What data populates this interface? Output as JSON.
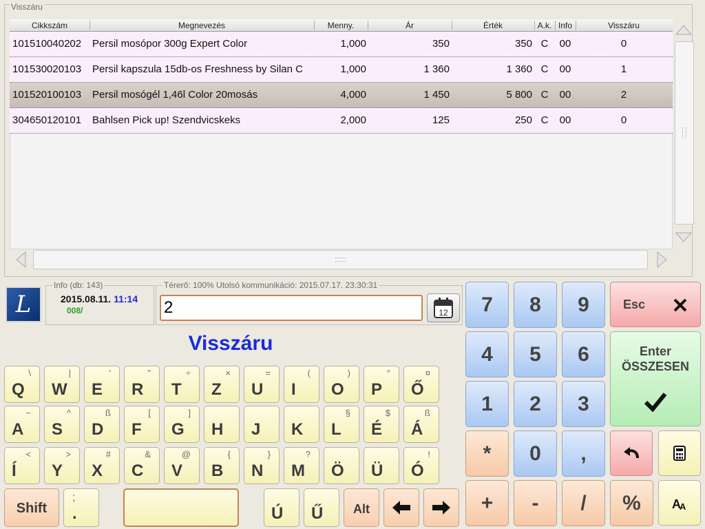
{
  "group_title": "Visszáru",
  "table": {
    "headers": [
      "Cikkszám",
      "Megnevezés",
      "Menny.",
      "Ár",
      "Érték",
      "A.k.",
      "Info",
      "Visszáru"
    ],
    "rows": [
      {
        "code": "101510040202",
        "name": "Persil mosópor 300g Expert Color",
        "qty": "1,000",
        "price": "350",
        "value": "350",
        "ak": "C",
        "info": "00",
        "ret": "0"
      },
      {
        "code": "101530020103",
        "name": "Persil kapszula 15db-os Freshness by Silan C",
        "qty": "1,000",
        "price": "1 360",
        "value": "1 360",
        "ak": "C",
        "info": "00",
        "ret": "1"
      },
      {
        "code": "101520100103",
        "name": "Persil mosógél 1,46l Color 20mosás",
        "qty": "4,000",
        "price": "1 450",
        "value": "5 800",
        "ak": "C",
        "info": "00",
        "ret": "2"
      },
      {
        "code": "304650120101",
        "name": "Bahlsen Pick up! Szendvicskeks",
        "qty": "2,000",
        "price": "125",
        "value": "250",
        "ak": "C",
        "info": "00",
        "ret": "0"
      }
    ],
    "selected_row": 2
  },
  "info": {
    "label": "Info (db: 143)",
    "date": "2015.08.11.",
    "time": "11:14",
    "code": "008/"
  },
  "status": {
    "label": "Térerő: 100%  Utolsó kommunikáció: 2015.07.17. 23:30:31"
  },
  "input": {
    "value": "2"
  },
  "calendar_day": "12",
  "mode_title": "Visszáru",
  "keyboard": {
    "row1": [
      {
        "m": "Q",
        "s": "\\"
      },
      {
        "m": "W",
        "s": "|"
      },
      {
        "m": "E",
        "s": "'"
      },
      {
        "m": "R",
        "s": "\""
      },
      {
        "m": "T",
        "s": "÷"
      },
      {
        "m": "Z",
        "s": "×"
      },
      {
        "m": "U",
        "s": "="
      },
      {
        "m": "I",
        "s": "("
      },
      {
        "m": "O",
        "s": ")"
      },
      {
        "m": "P",
        "s": "°"
      },
      {
        "m": "Ő",
        "s": "¤"
      }
    ],
    "row2": [
      {
        "m": "A",
        "s": "~"
      },
      {
        "m": "S",
        "s": "^"
      },
      {
        "m": "D",
        "s": "ß"
      },
      {
        "m": "F",
        "s": "["
      },
      {
        "m": "G",
        "s": "]"
      },
      {
        "m": "H",
        "s": ""
      },
      {
        "m": "J",
        "s": ""
      },
      {
        "m": "K",
        "s": ""
      },
      {
        "m": "L",
        "s": "§"
      },
      {
        "m": "É",
        "s": "$"
      },
      {
        "m": "Á",
        "s": "ß"
      }
    ],
    "row3": [
      {
        "m": "Í",
        "s": "<"
      },
      {
        "m": "Y",
        "s": ">"
      },
      {
        "m": "X",
        "s": "#"
      },
      {
        "m": "C",
        "s": "&"
      },
      {
        "m": "V",
        "s": "@"
      },
      {
        "m": "B",
        "s": "{"
      },
      {
        "m": "N",
        "s": "}"
      },
      {
        "m": "M",
        "s": "?"
      },
      {
        "m": "Ö",
        "s": ""
      },
      {
        "m": "Ü",
        "s": ""
      },
      {
        "m": "Ó",
        "s": "!"
      }
    ],
    "shift": "Shift",
    "semi_top": ";",
    "semi_bottom": ".",
    "u_acute": "Ú",
    "u_dbl": "Ű",
    "alt": "Alt"
  },
  "numpad": {
    "keys": [
      "7",
      "8",
      "9",
      "4",
      "5",
      "6",
      "1",
      "2",
      "3",
      "*",
      "0",
      ",",
      "+",
      "-",
      "/",
      "%"
    ],
    "esc": "Esc",
    "enter_line1": "Enter",
    "enter_line2": "ÖSSZESEN"
  }
}
